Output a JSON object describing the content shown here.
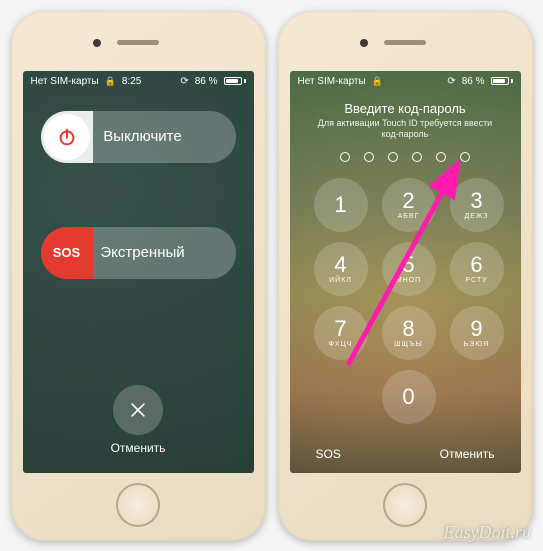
{
  "watermark": "EasyDoit.ru",
  "phone1": {
    "status": {
      "carrier": "Нет SIM-карты",
      "time": "8:25",
      "battery_pct": "86 %"
    },
    "power_slider_label": "Выключите",
    "sos_knob_text": "SOS",
    "sos_slider_label": "Экстренный",
    "cancel_label": "Отменить"
  },
  "phone2": {
    "status": {
      "carrier": "Нет SIM-карты",
      "battery_pct": "86 %"
    },
    "title": "Введите код-пароль",
    "subtitle": "Для активации Touch ID требуется ввести код-пароль",
    "keys": [
      {
        "num": "1",
        "letters": ""
      },
      {
        "num": "2",
        "letters": "АБВГ"
      },
      {
        "num": "3",
        "letters": "ДЕЖЗ"
      },
      {
        "num": "4",
        "letters": "ИЙКЛ"
      },
      {
        "num": "5",
        "letters": "МНОП"
      },
      {
        "num": "6",
        "letters": "РСТУ"
      },
      {
        "num": "7",
        "letters": "ФХЦЧ"
      },
      {
        "num": "8",
        "letters": "ШЩЪЫ"
      },
      {
        "num": "9",
        "letters": "ЬЭЮЯ"
      },
      {
        "num": "0",
        "letters": ""
      }
    ],
    "sos_label": "SOS",
    "cancel_label": "Отменить"
  }
}
